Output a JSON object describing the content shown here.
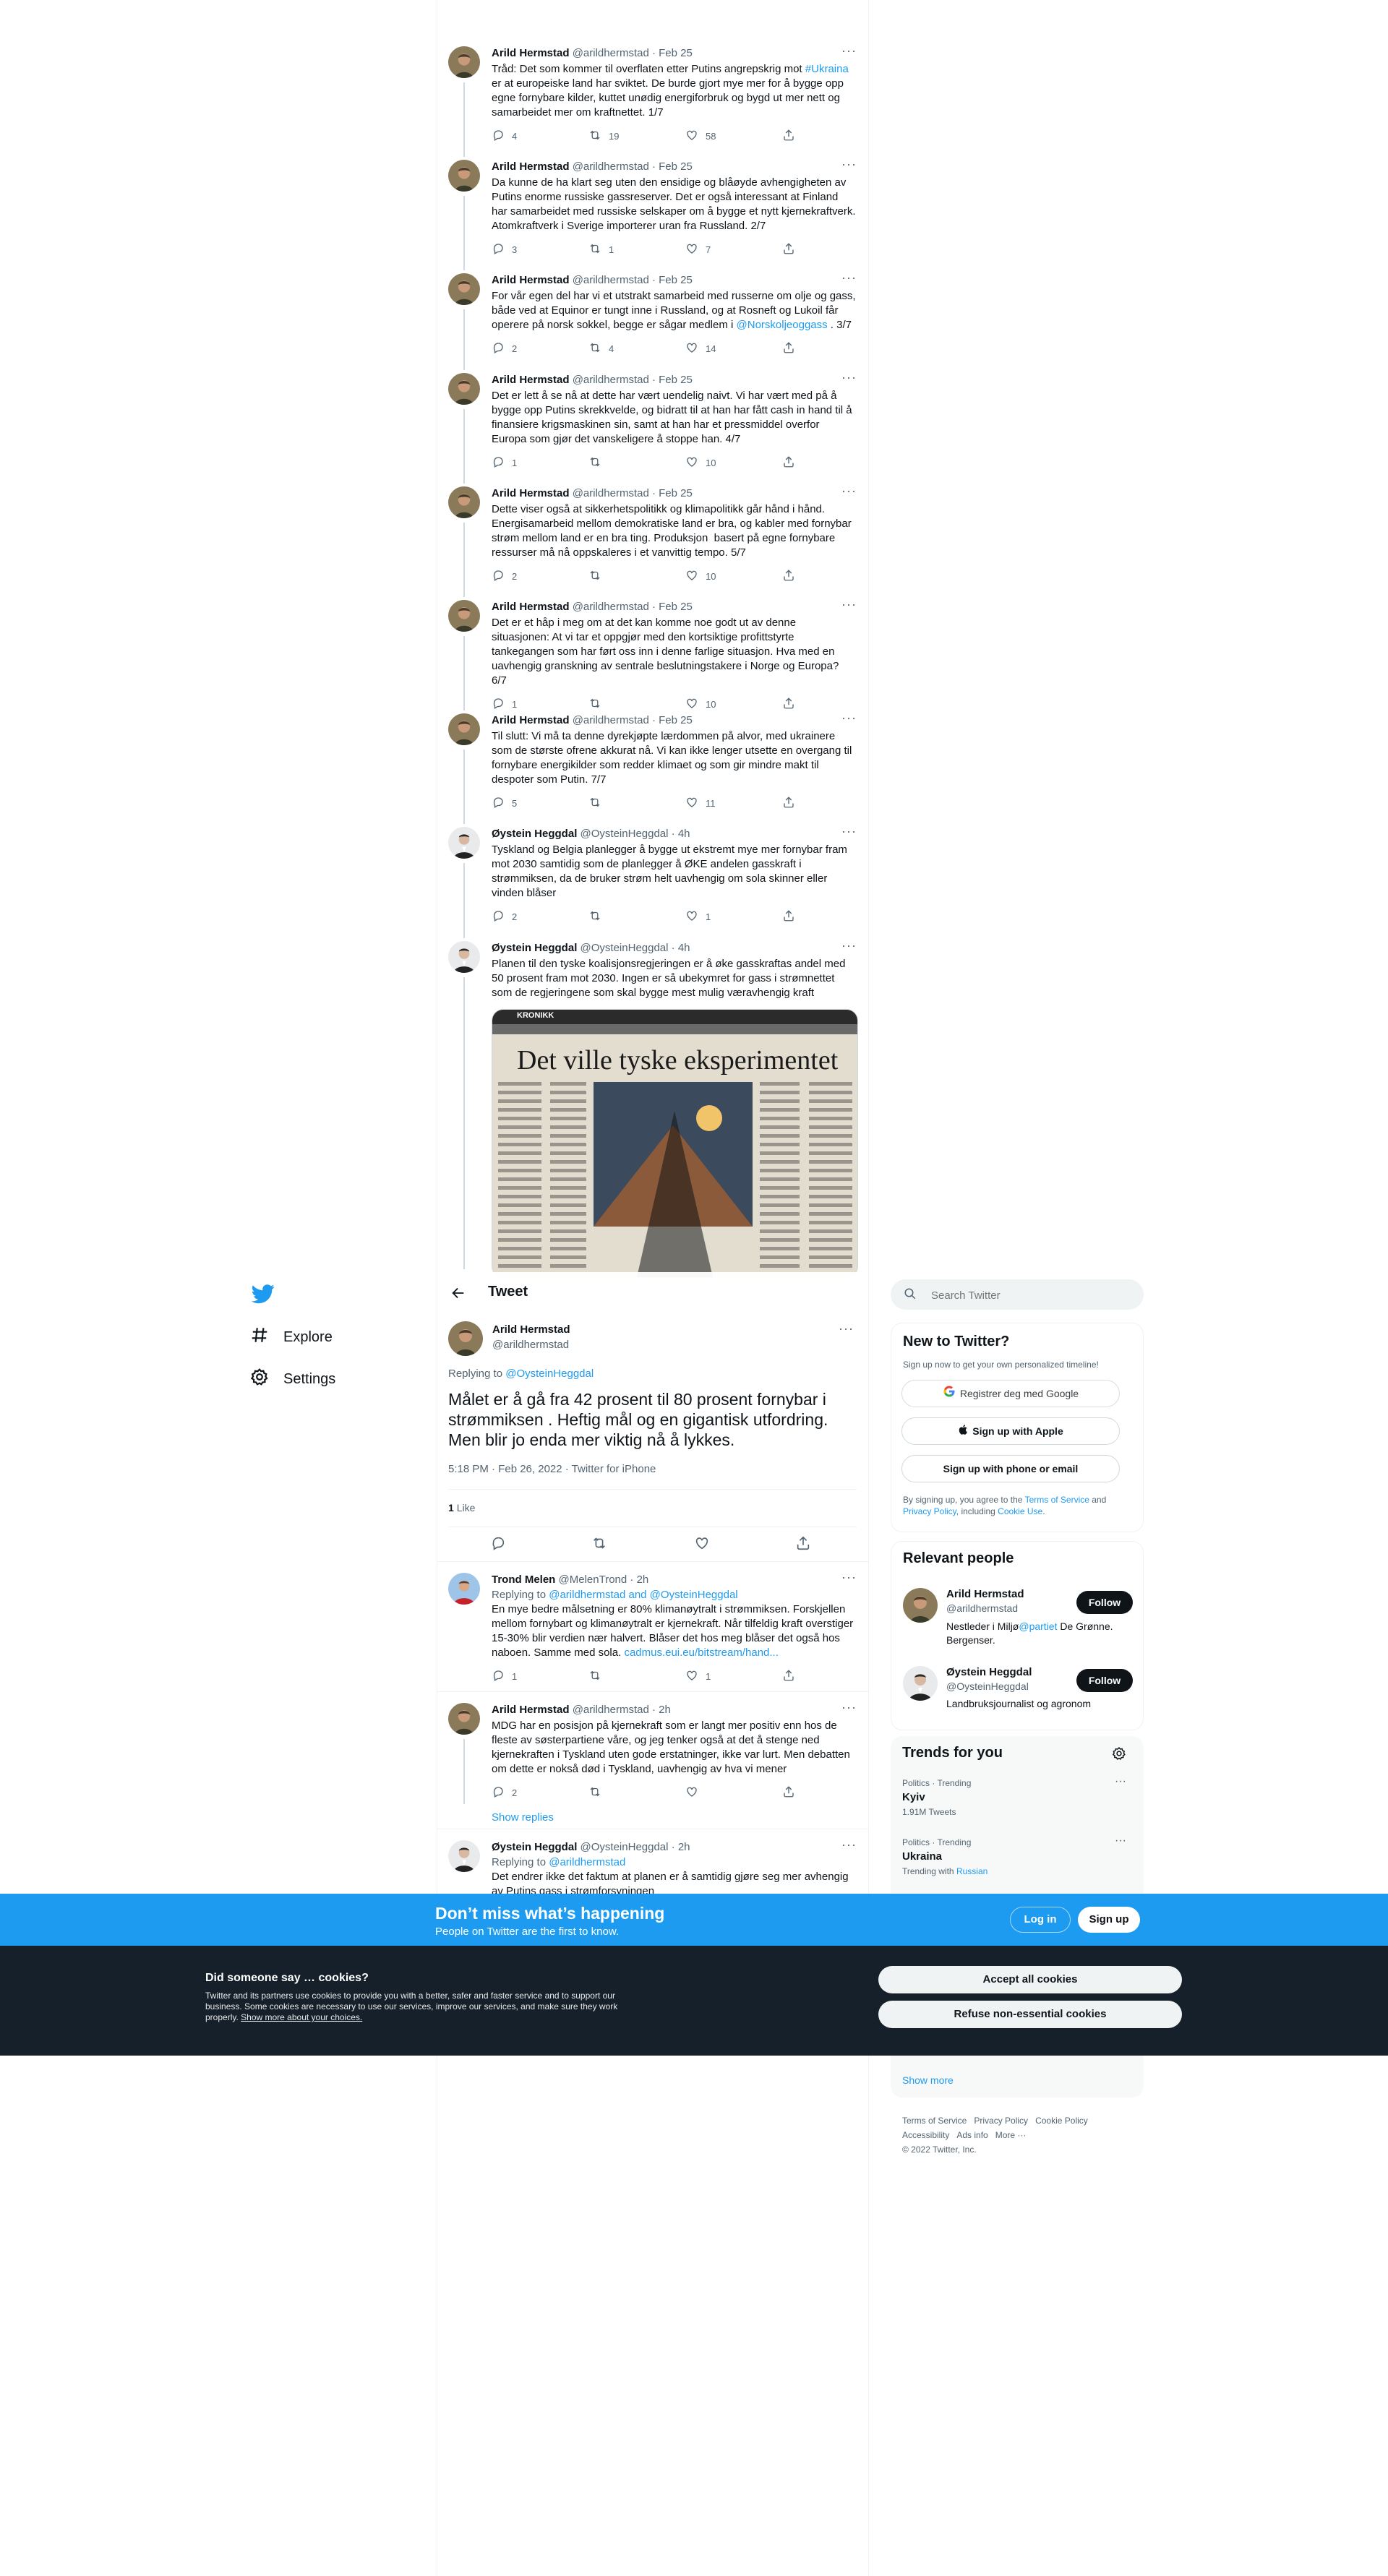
{
  "thread": [
    {
      "name": "Arild Hermstad",
      "handle": "@arildhermstad",
      "time": "· Feb 25",
      "avatar": "avatar-arild",
      "text_parts": [
        "Tråd: Det som kommer til overflaten etter Putins angrepskrig mot ",
        {
          "link": "#Ukraina"
        },
        " er at europeiske land har sviktet. De burde gjort mye mer for å bygge opp egne fornybare kilder, kuttet unødig energiforbruk og bygd ut mer nett og samarbeidet mer om kraftnettet. 1/7"
      ],
      "replies": "4",
      "retweets": "19",
      "likes": "58"
    },
    {
      "name": "Arild Hermstad",
      "handle": "@arildhermstad",
      "time": "· Feb 25",
      "avatar": "avatar-arild",
      "text_parts": [
        "Da kunne de ha klart seg uten den ensidige og blåøyde avhengigheten av Putins enorme russiske gassreserver. Det er også interessant at Finland har samarbeidet med russiske selskaper om å bygge et nytt kjernekraftverk. Atomkraftverk i Sverige importerer uran fra Russland. 2/7"
      ],
      "replies": "3",
      "retweets": "1",
      "likes": "7"
    },
    {
      "name": "Arild Hermstad",
      "handle": "@arildhermstad",
      "time": "· Feb 25",
      "avatar": "avatar-arild",
      "text_parts": [
        "For vår egen del har vi et utstrakt samarbeid med russerne om olje og gass, både ved at Equinor er tungt inne i Russland, og at Rosneft og Lukoil får operere på norsk sokkel, begge er sågar medlem i ",
        {
          "link": "@Norskoljeoggass"
        },
        " . 3/7"
      ],
      "replies": "2",
      "retweets": "4",
      "likes": "14"
    },
    {
      "name": "Arild Hermstad",
      "handle": "@arildhermstad",
      "time": "· Feb 25",
      "avatar": "avatar-arild",
      "text_parts": [
        "Det er lett å se nå at dette har vært uendelig naivt. Vi har vært med på å bygge opp Putins skrekkvelde, og bidratt til at han har fått cash in hand til å finansiere krigsmaskinen sin, samt at han har et pressmiddel overfor Europa som gjør det vanskeligere å stoppe han. 4/7"
      ],
      "replies": "1",
      "retweets": "",
      "likes": "10"
    },
    {
      "name": "Arild Hermstad",
      "handle": "@arildhermstad",
      "time": "· Feb 25",
      "avatar": "avatar-arild",
      "text_parts": [
        "Dette viser også at sikkerhetspolitikk og klimapolitikk går hånd i hånd. Energisamarbeid mellom demokratiske land er bra, og kabler med fornybar strøm mellom land er en bra ting. Produksjon  basert på egne fornybare ressurser må nå oppskaleres i et vanvittig tempo. 5/7"
      ],
      "replies": "2",
      "retweets": "",
      "likes": "10"
    },
    {
      "name": "Arild Hermstad",
      "handle": "@arildhermstad",
      "time": "· Feb 25",
      "avatar": "avatar-arild",
      "text_parts": [
        "Det er et håp i meg om at det kan komme noe godt ut av denne situasjonen: At vi tar et oppgjør med den kortsiktige profittstyrte tankegangen som har ført oss inn i denne farlige situasjon. Hva med en uavhengig granskning av sentrale beslutningstakere i Norge og Europa? 6/7"
      ],
      "replies": "1",
      "retweets": "",
      "likes": "10"
    },
    {
      "name": "Arild Hermstad",
      "handle": "@arildhermstad",
      "time": "· Feb 25",
      "avatar": "avatar-arild",
      "text_parts": [
        "Til slutt: Vi må ta denne dyrekjøpte lærdommen på alvor, med ukrainere som de største ofrene akkurat nå. Vi kan ikke lenger utsette en overgang til fornybare energikilder som redder klimaet og som gir mindre makt til despoter som Putin. 7/7"
      ],
      "replies": "5",
      "retweets": "",
      "likes": "11"
    },
    {
      "name": "Øystein Heggdal",
      "handle": "@OysteinHeggdal",
      "time": "· 4h",
      "avatar": "avatar-oystein",
      "text_parts": [
        "Tyskland og Belgia planlegger å bygge ut ekstremt mye mer fornybar fram mot 2030 samtidig som de planlegger å ØKE andelen gasskraft i strømmiksen, da de bruker strøm helt uavhengig om sola skinner eller vinden blåser"
      ],
      "replies": "2",
      "retweets": "",
      "likes": "1"
    },
    {
      "name": "Øystein Heggdal",
      "handle": "@OysteinHeggdal",
      "time": "· 4h",
      "avatar": "avatar-oystein",
      "text_parts": [
        "Planen til den tyske koalisjonsregjeringen er å øke gasskraftas andel med 50 prosent fram mot 2030. Ingen er så ubekymret for gass i strømnettet som de regjeringene som skal bygge mest mulig væravhengig kraft"
      ],
      "image": {
        "kicker": "KRONIKK",
        "headline": "Det ville tyske eksperimentet"
      }
    }
  ],
  "sidebar": {
    "explore": "Explore",
    "settings": "Settings"
  },
  "header": {
    "title": "Tweet"
  },
  "main_tweet": {
    "name": "Arild Hermstad",
    "handle": "@arildhermstad",
    "replying_prefix": "Replying to ",
    "replying_to": "@OysteinHeggdal",
    "text": "Målet er å gå fra 42 prosent til 80 prosent fornybar i strømmiksen . Heftig mål og en gigantisk utfordring. Men blir jo enda mer viktig nå å lykkes.",
    "timestamp": "5:18 PM · Feb 26, 2022 · Twitter for iPhone",
    "likes_count": "1",
    "likes_label": "Like"
  },
  "replies": [
    {
      "name": "Trond Melen",
      "handle": "@MelenTrond",
      "time": "· 2h",
      "avatar": "avatar-trond",
      "replying": "@arildhermstad and @OysteinHeggdal",
      "text": "En mye bedre målsetning er 80% klimanøytralt i strømmiksen. Forskjellen mellom fornybart og klimanøytralt er kjernekraft. Når tilfeldig kraft overstiger 15-30% blir verdien nær halvert. Blåser det hos meg blåser det også hos naboen. Samme med sola. ",
      "link": "cadmus.eui.eu/bitstream/hand...",
      "replies": "1",
      "retweets": "",
      "likes": "1"
    },
    {
      "name": "Arild Hermstad",
      "handle": "@arildhermstad",
      "time": "· 2h",
      "avatar": "avatar-arild",
      "text": "MDG har en posisjon på kjernekraft som er langt mer positiv enn hos de fleste av søsterpartiene våre, og jeg tenker også at det å stenge ned kjernekraften i Tyskland uten gode erstatninger, ikke var lurt. Men debatten om dette er nokså død i Tyskland, uavhengig av hva vi mener",
      "replies": "2",
      "retweets": "",
      "likes": ""
    },
    {
      "name": "Øystein Heggdal",
      "handle": "@OysteinHeggdal",
      "time": "· 2h",
      "avatar": "avatar-oystein",
      "replying": "@arildhermstad",
      "text": "Det endrer ikke det faktum at planen er å samtidig gjøre seg mer avhengig av Putins gass i strømforsyningen"
    }
  ],
  "show_replies": "Show replies",
  "right": {
    "search_placeholder": "Search Twitter",
    "new_title": "New to Twitter?",
    "new_sub": "Sign up now to get your own personalized timeline!",
    "google_btn": "Registrer deg med Google",
    "apple_btn": "Sign up with Apple",
    "phone_btn": "Sign up with phone or email",
    "terms_1": "By signing up, you agree to the ",
    "terms_link1": "Terms of Service",
    "terms_2": " and ",
    "terms_link2": "Privacy Policy",
    "terms_3": ", including ",
    "terms_link3": "Cookie Use",
    "terms_4": ".",
    "relevant_title": "Relevant people",
    "people": [
      {
        "name": "Arild Hermstad",
        "handle": "@arildhermstad",
        "bio_1": "Nestleder i Miljø",
        "bio_link": "@partiet",
        "bio_2": " De Grønne. Bergenser.",
        "follow": "Follow"
      },
      {
        "name": "Øystein Heggdal",
        "handle": "@OysteinHeggdal",
        "bio_1": "Landbruksjournalist og agronom",
        "follow": "Follow"
      }
    ],
    "trends_title": "Trends for you",
    "trends": [
      {
        "context": "Politics · Trending",
        "name": "Kyiv",
        "meta": "1.91M Tweets"
      },
      {
        "context": "Politics · Trending",
        "name": "Ukraina",
        "meta_prefix": "Trending with ",
        "meta_link": "Russian"
      }
    ],
    "show_more": "Show more",
    "footer": [
      "Terms of Service",
      "Privacy Policy",
      "Cookie Policy",
      "Accessibility",
      "Ads info",
      "More ···"
    ],
    "copyright": "© 2022 Twitter, Inc."
  },
  "banner": {
    "title": "Don’t miss what’s happening",
    "sub": "People on Twitter are the first to know.",
    "login": "Log in",
    "signup": "Sign up"
  },
  "cookies": {
    "title": "Did someone say … cookies?",
    "text": "Twitter and its partners use cookies to provide you with a better, safer and faster service and to support our business. Some cookies are necessary to use our services, improve our services, and make sure they work properly. ",
    "link": "Show more about your choices.",
    "accept": "Accept all cookies",
    "refuse": "Refuse non-essential cookies"
  },
  "colors": {
    "accent": "#1d9bf0",
    "banner": "#1d9bf0",
    "cookie_bg": "#15202b"
  }
}
